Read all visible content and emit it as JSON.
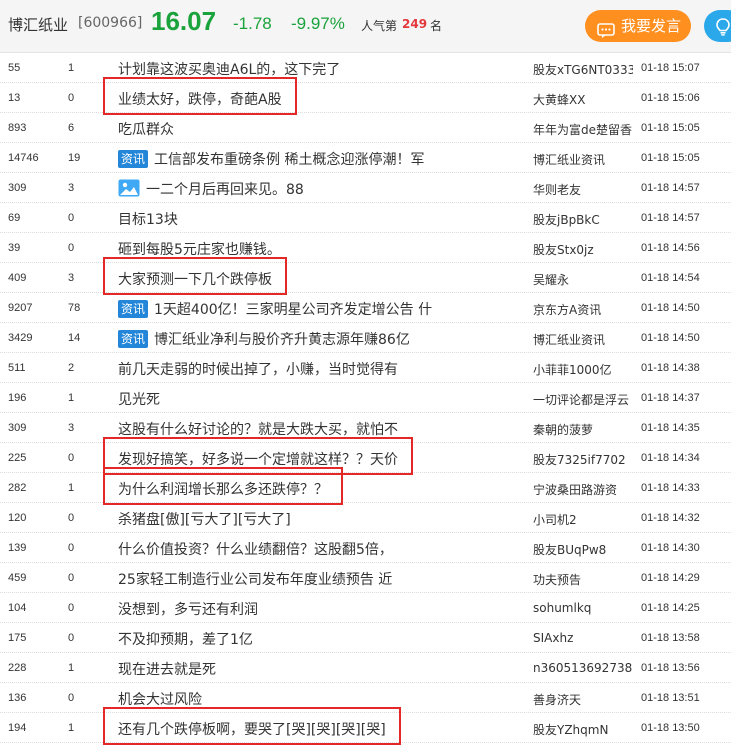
{
  "header": {
    "stock_name": "博汇纸业",
    "stock_code": "[600966]",
    "price": "16.07",
    "change": "-1.78",
    "change_pct": "-9.97%",
    "rank_label": "人气第",
    "rank_value": "249",
    "rank_unit": "名",
    "post_label": "我要发言",
    "price_color": "#1aa33b",
    "post_button_color": "#ff8f1f",
    "tip_button_color": "#2aa8ea"
  },
  "badge_label": "资讯",
  "posts": [
    {
      "reads": "55",
      "replies": "1",
      "title": "计划靠这波买奥迪A6L的，这下完了",
      "author": "股友xTG6NT0333",
      "time": "01-18  15:07",
      "highlighted": false
    },
    {
      "reads": "13",
      "replies": "0",
      "title": "业绩太好，跌停，奇葩A股",
      "author": "大黄蜂XX",
      "time": "01-18  15:06",
      "highlighted": true
    },
    {
      "reads": "893",
      "replies": "6",
      "title": "吃瓜群众",
      "author": "年年为富de楚留香",
      "time": "01-18  15:05",
      "highlighted": false
    },
    {
      "reads": "14746",
      "replies": "19",
      "title": "工信部发布重磅条例 稀土概念迎涨停潮！军",
      "author": "博汇纸业资讯",
      "time": "01-18  15:05",
      "badge": true,
      "highlighted": false
    },
    {
      "reads": "309",
      "replies": "3",
      "title": "一二个月后再回来见。88",
      "author": "华则老友",
      "time": "01-18  14:57",
      "image_icon": true,
      "highlighted": false
    },
    {
      "reads": "69",
      "replies": "0",
      "title": "目标13块",
      "author": "股友jBpBkC",
      "time": "01-18  14:57",
      "highlighted": false
    },
    {
      "reads": "39",
      "replies": "0",
      "title": "砸到每股5元庄家也赚钱。",
      "author": "股友Stx0jz",
      "time": "01-18  14:56",
      "highlighted": false
    },
    {
      "reads": "409",
      "replies": "3",
      "title": "大家预测一下几个跌停板",
      "author": "吴耀永",
      "time": "01-18  14:54",
      "highlighted": true
    },
    {
      "reads": "9207",
      "replies": "78",
      "title": "1天超400亿！三家明星公司齐发定增公告 什",
      "author": "京东方A资讯",
      "time": "01-18  14:50",
      "badge": true,
      "highlighted": false
    },
    {
      "reads": "3429",
      "replies": "14",
      "title": "博汇纸业净利与股价齐升黄志源年赚86亿",
      "author": "博汇纸业资讯",
      "time": "01-18  14:50",
      "badge": true,
      "highlighted": false
    },
    {
      "reads": "511",
      "replies": "2",
      "title": "前几天走弱的时候出掉了，小赚，当时觉得有",
      "author": "小菲菲1000亿",
      "time": "01-18  14:38",
      "highlighted": false
    },
    {
      "reads": "196",
      "replies": "1",
      "title": "见光死",
      "author": "一切评论都是浮云",
      "time": "01-18  14:37",
      "highlighted": false
    },
    {
      "reads": "309",
      "replies": "3",
      "title": "这股有什么好讨论的？就是大跌大买，就怕不",
      "author": "秦朝的菠萝",
      "time": "01-18  14:35",
      "highlighted": false
    },
    {
      "reads": "225",
      "replies": "0",
      "title": "发现好搞笑，好多说一个定增就这样？？天价",
      "author": "股友7325if7702",
      "time": "01-18  14:34",
      "highlighted": true
    },
    {
      "reads": "282",
      "replies": "1",
      "title": "为什么利润增长那么多还跌停？？",
      "author": "宁波桑田路游资",
      "time": "01-18  14:33",
      "highlighted": true
    },
    {
      "reads": "120",
      "replies": "0",
      "title": "杀猪盘[傲][亏大了][亏大了]",
      "author": "小司机2",
      "time": "01-18  14:32",
      "highlighted": false
    },
    {
      "reads": "139",
      "replies": "0",
      "title": "什么价值投资？什么业绩翻倍？这股翻5倍，",
      "author": "股友BUqPw8",
      "time": "01-18  14:30",
      "highlighted": false
    },
    {
      "reads": "459",
      "replies": "0",
      "title": "25家轻工制造行业公司发布年度业绩预告 近",
      "author": "功夫预告",
      "time": "01-18  14:29",
      "highlighted": false
    },
    {
      "reads": "104",
      "replies": "0",
      "title": "没想到，多亏还有利润",
      "author": "sohumlkq",
      "time": "01-18  14:25",
      "highlighted": false
    },
    {
      "reads": "175",
      "replies": "0",
      "title": "不及抑预期，差了1亿",
      "author": "SIAxhz",
      "time": "01-18  13:58",
      "highlighted": false
    },
    {
      "reads": "228",
      "replies": "1",
      "title": "现在进去就是死",
      "author": "n360513692738692",
      "time": "01-18  13:56",
      "highlighted": false
    },
    {
      "reads": "136",
      "replies": "0",
      "title": "机会大过风险",
      "author": "善身济天",
      "time": "01-18  13:51",
      "highlighted": false
    },
    {
      "reads": "194",
      "replies": "1",
      "title": "还有几个跌停板啊，要哭了[哭][哭][哭][哭]",
      "author": "股友YZhqmN",
      "time": "01-18  13:50",
      "highlighted": true
    }
  ]
}
